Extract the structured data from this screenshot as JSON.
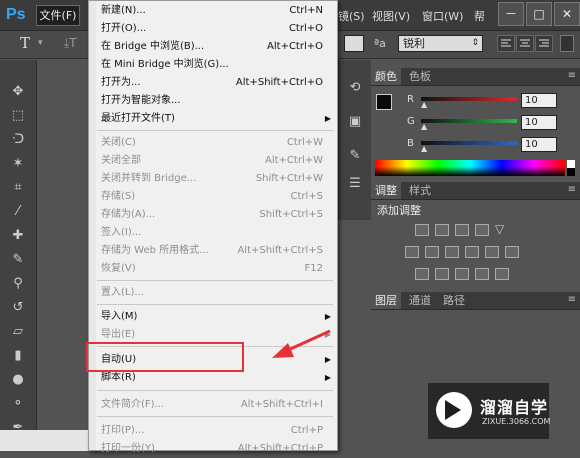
{
  "app": {
    "logo": "Ps"
  },
  "menubar": {
    "file_label": "文件(F)",
    "partial_menus": [
      {
        "label": "镜(S)"
      },
      {
        "label": "视图(V)"
      },
      {
        "label": "窗口(W)"
      },
      {
        "label": "帮"
      }
    ],
    "window_controls": [
      "－",
      "□",
      "✕"
    ]
  },
  "options_bar": {
    "antialias_label": "ªa",
    "antialias_value": "锐利"
  },
  "color_panel": {
    "tabs": [
      "颜色",
      "色板"
    ],
    "channels": [
      {
        "label": "R",
        "value": "10",
        "color": "#e0262a"
      },
      {
        "label": "G",
        "value": "10",
        "color": "#2fb84a"
      },
      {
        "label": "B",
        "value": "10",
        "color": "#2f66c9"
      }
    ]
  },
  "adjust_panel": {
    "tabs": [
      "调整",
      "样式"
    ],
    "title": "添加调整"
  },
  "layers_panel": {
    "tabs": [
      "图层",
      "通道",
      "路径"
    ]
  },
  "file_menu": {
    "items": [
      {
        "label": "新建(N)...",
        "shortcut": "Ctrl+N",
        "enabled": true
      },
      {
        "label": "打开(O)...",
        "shortcut": "Ctrl+O",
        "enabled": true
      },
      {
        "label": "在 Bridge 中浏览(B)...",
        "shortcut": "Alt+Ctrl+O",
        "enabled": true
      },
      {
        "label": "在 Mini Bridge 中浏览(G)...",
        "shortcut": "",
        "enabled": true
      },
      {
        "label": "打开为...",
        "shortcut": "Alt+Shift+Ctrl+O",
        "enabled": true
      },
      {
        "label": "打开为智能对象...",
        "shortcut": "",
        "enabled": true
      },
      {
        "label": "最近打开文件(T)",
        "shortcut": "",
        "enabled": true,
        "submenu": true
      },
      {
        "label": "关闭(C)",
        "shortcut": "Ctrl+W",
        "enabled": false
      },
      {
        "label": "关闭全部",
        "shortcut": "Alt+Ctrl+W",
        "enabled": false
      },
      {
        "label": "关闭并转到 Bridge...",
        "shortcut": "Shift+Ctrl+W",
        "enabled": false
      },
      {
        "label": "存储(S)",
        "shortcut": "Ctrl+S",
        "enabled": false
      },
      {
        "label": "存储为(A)...",
        "shortcut": "Shift+Ctrl+S",
        "enabled": false
      },
      {
        "label": "签入(I)...",
        "shortcut": "",
        "enabled": false
      },
      {
        "label": "存储为 Web 所用格式...",
        "shortcut": "Alt+Shift+Ctrl+S",
        "enabled": false
      },
      {
        "label": "恢复(V)",
        "shortcut": "F12",
        "enabled": false
      },
      {
        "label": "置入(L)...",
        "shortcut": "",
        "enabled": false
      },
      {
        "label": "导入(M)",
        "shortcut": "",
        "enabled": true,
        "submenu": true
      },
      {
        "label": "导出(E)",
        "shortcut": "",
        "enabled": false,
        "submenu": true
      },
      {
        "label": "自动(U)",
        "shortcut": "",
        "enabled": true,
        "submenu": true
      },
      {
        "label": "脚本(R)",
        "shortcut": "",
        "enabled": true,
        "submenu": true
      },
      {
        "label": "文件简介(F)...",
        "shortcut": "Alt+Shift+Ctrl+I",
        "enabled": false
      },
      {
        "label": "打印(P)...",
        "shortcut": "Ctrl+P",
        "enabled": false
      },
      {
        "label": "打印一份(Y)",
        "shortcut": "Alt+Shift+Ctrl+P",
        "enabled": false
      }
    ]
  },
  "watermark": {
    "title": "溜溜自学",
    "url": "ZIXUE.3066.COM"
  }
}
